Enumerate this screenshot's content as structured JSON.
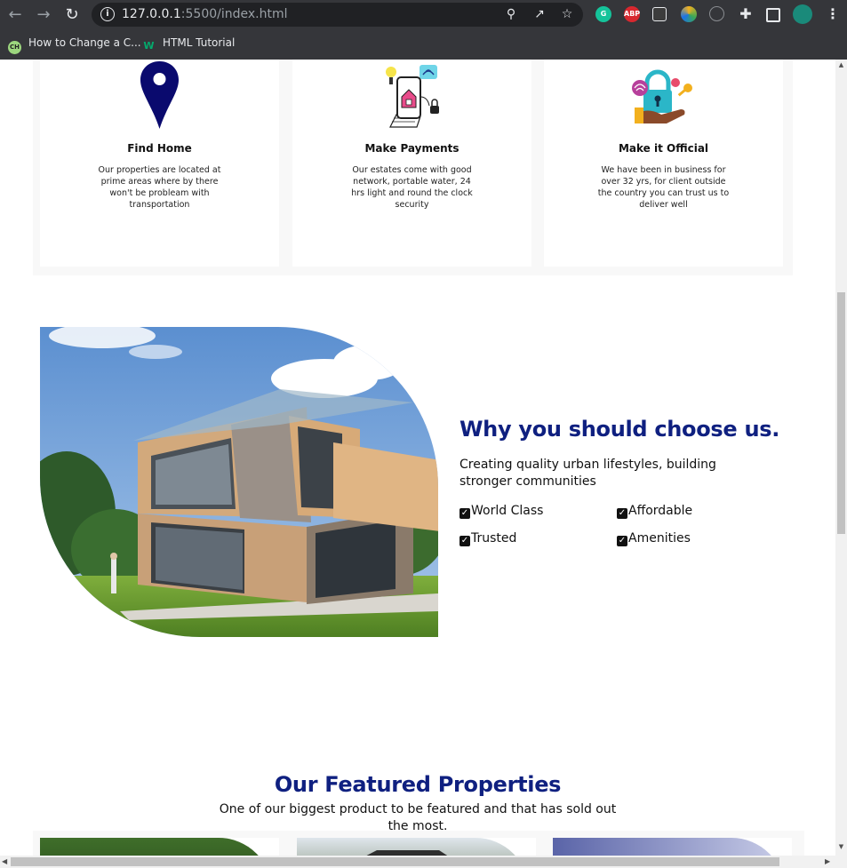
{
  "browser": {
    "url_host": "127.0.0.1",
    "url_rest": ":5500/index.html",
    "bookmarks": [
      {
        "label": "How to Change a C...",
        "icon": "codehub-favicon"
      },
      {
        "label": "HTML Tutorial",
        "icon": "w3schools-favicon"
      }
    ],
    "extensions": [
      {
        "name": "grammarly-icon",
        "text": "G",
        "color": "#15c39a"
      },
      {
        "name": "adblock-plus-icon",
        "text": "ABP",
        "color": "#d7282f"
      },
      {
        "name": "bitwarden-icon",
        "text": "",
        "color": "#ffffff"
      },
      {
        "name": "color-picker-icon",
        "text": "",
        "color": "#f2b01e"
      },
      {
        "name": "stats-icon",
        "text": "",
        "color": "#5f6368"
      }
    ]
  },
  "features": [
    {
      "title": "Find Home",
      "text": "Our properties are located at prime areas where by there won't be probleam with transportation",
      "icon": "map-pin-icon",
      "color": "#0a0a6e"
    },
    {
      "title": "Make Payments",
      "text": "Our estates come with good network, portable water, 24 hrs light and round the clock security",
      "icon": "phone-house-icon",
      "color": "#e84b8a"
    },
    {
      "title": "Make it Official",
      "text": "We have been in business for over 32 yrs, for client outside the country you can trust us to deliver well",
      "icon": "padlock-key-icon",
      "color": "#2bb6c8"
    }
  ],
  "why": {
    "title": "Why you should choose us.",
    "subtitle": "Creating quality urban lifestyles, building stronger communities",
    "checks": [
      "World Class",
      "Affordable",
      "Trusted",
      "Amenities"
    ]
  },
  "featured": {
    "title": "Our Featured Properties",
    "subtitle": "One of our biggest product to be featured and that has sold out the most."
  },
  "colors": {
    "heading": "#0f2080",
    "chrome_bg": "#35363a",
    "omnibox_bg": "#202124"
  }
}
